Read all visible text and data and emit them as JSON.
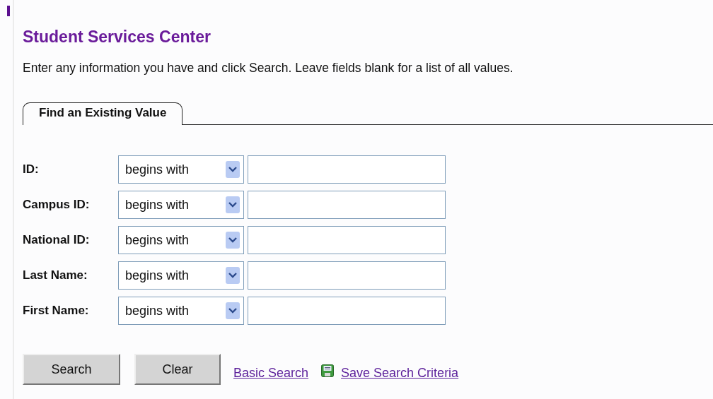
{
  "page": {
    "title": "Student Services Center",
    "instructions": "Enter any information you have and click Search. Leave fields blank for a list of all values."
  },
  "tabs": [
    {
      "label": "Find an Existing Value",
      "selected": true
    }
  ],
  "fields": [
    {
      "label": "ID:",
      "operator": "begins with"
    },
    {
      "label": "Campus ID:",
      "operator": "begins with"
    },
    {
      "label": "National ID:",
      "operator": "begins with"
    },
    {
      "label": "Last Name:",
      "operator": "begins with"
    },
    {
      "label": "First Name:",
      "operator": "begins with"
    }
  ],
  "buttons": [
    "Search",
    "Clear"
  ],
  "links": [
    {
      "label": "Basic Search",
      "icon": false
    },
    {
      "label": "Save Search Criteria",
      "icon": true
    }
  ]
}
